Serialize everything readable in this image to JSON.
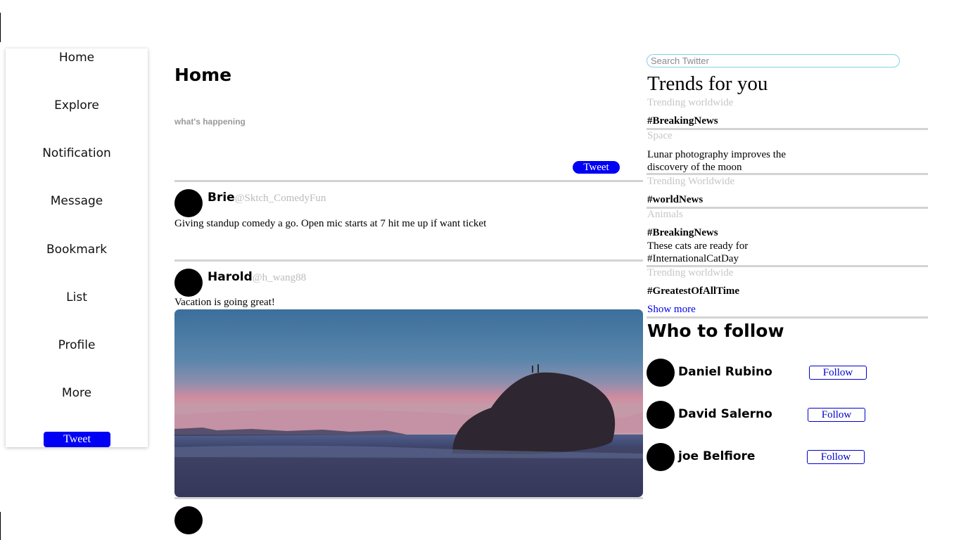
{
  "sidebar": {
    "items": [
      {
        "label": "Home"
      },
      {
        "label": "Explore"
      },
      {
        "label": "Notification"
      },
      {
        "label": "Message"
      },
      {
        "label": "Bookmark"
      },
      {
        "label": "List"
      },
      {
        "label": "Profile"
      },
      {
        "label": "More"
      }
    ],
    "tweet_button": "Tweet"
  },
  "main": {
    "title": "Home",
    "compose": {
      "placeholder": "what's happening",
      "value": "",
      "tweet_button": "Tweet"
    },
    "posts": [
      {
        "name": "Brie",
        "handle": "@Sktch_ComedyFun",
        "text": "Giving standup comedy a go. Open mic starts at 7 hit me up if want ticket"
      },
      {
        "name": "Harold",
        "handle": "@h_wang88",
        "text": "Vacation is going great!",
        "image": "beach-sunset-rock-photo"
      }
    ]
  },
  "right": {
    "search": {
      "placeholder": "Search Twitter",
      "value": ""
    },
    "trends_title": "Trends for you",
    "trends": [
      {
        "category": "Trending worldwide",
        "tag": "#BreakingNews",
        "text": ""
      },
      {
        "category": "Space",
        "tag": "",
        "text": "Lunar photography improves the discovery of the moon"
      },
      {
        "category": "Trending Worldwide",
        "tag": "#worldNews",
        "text": ""
      },
      {
        "category": "Animals",
        "tag": "#BreakingNews",
        "text": "These cats are ready for #InternationalCatDay"
      },
      {
        "category": "Trending worldwide",
        "tag": "#GreatestOfAllTime",
        "text": ""
      }
    ],
    "show_more": "Show more",
    "follow_title": "Who to follow",
    "follow": [
      {
        "name": "Daniel Rubino",
        "button": "Follow"
      },
      {
        "name": "David Salerno",
        "button": "Follow"
      },
      {
        "name": "joe Belfiore",
        "button": "Follow"
      }
    ]
  },
  "colors": {
    "accent": "#0000f5",
    "link": "#0000ee",
    "muted": "#c6c6c6",
    "divider": "#d3d3d3",
    "search_border": "#7fd3e6"
  }
}
